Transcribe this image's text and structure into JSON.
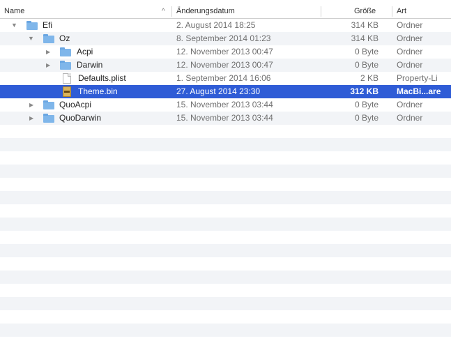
{
  "header": {
    "name": "Name",
    "date": "Änderungsdatum",
    "size": "Größe",
    "kind": "Art",
    "sort_icon": "chevron-up-icon"
  },
  "rows": [
    {
      "name": "Efi",
      "date": "2. August 2014 18:25",
      "size": "314 KB",
      "kind": "Ordner",
      "icon": "folder-icon",
      "expanded": true
    },
    {
      "name": "Oz",
      "date": "8. September 2014 01:23",
      "size": "314 KB",
      "kind": "Ordner",
      "icon": "folder-icon",
      "expanded": true
    },
    {
      "name": "Acpi",
      "date": "12. November 2013 00:47",
      "size": "0 Byte",
      "kind": "Ordner",
      "icon": "folder-icon",
      "expanded": false
    },
    {
      "name": "Darwin",
      "date": "12. November 2013 00:47",
      "size": "0 Byte",
      "kind": "Ordner",
      "icon": "folder-icon",
      "expanded": false
    },
    {
      "name": "Defaults.plist",
      "date": "1. September 2014 16:06",
      "size": "2 KB",
      "kind": "Property-Li",
      "icon": "document-icon"
    },
    {
      "name": "Theme.bin",
      "date": "27. August 2014 23:30",
      "size": "312 KB",
      "kind": "MacBi...are",
      "icon": "binary-file-icon",
      "selected": true
    },
    {
      "name": "QuoAcpi",
      "date": "15. November 2013 03:44",
      "size": "0 Byte",
      "kind": "Ordner",
      "icon": "folder-icon",
      "expanded": false
    },
    {
      "name": "QuoDarwin",
      "date": "15. November 2013 03:44",
      "size": "0 Byte",
      "kind": "Ordner",
      "icon": "folder-icon",
      "expanded": false
    }
  ],
  "colors": {
    "selection": "#2f5cd6",
    "folder": "#7fb6ea",
    "zebra": "#f2f4f7"
  }
}
